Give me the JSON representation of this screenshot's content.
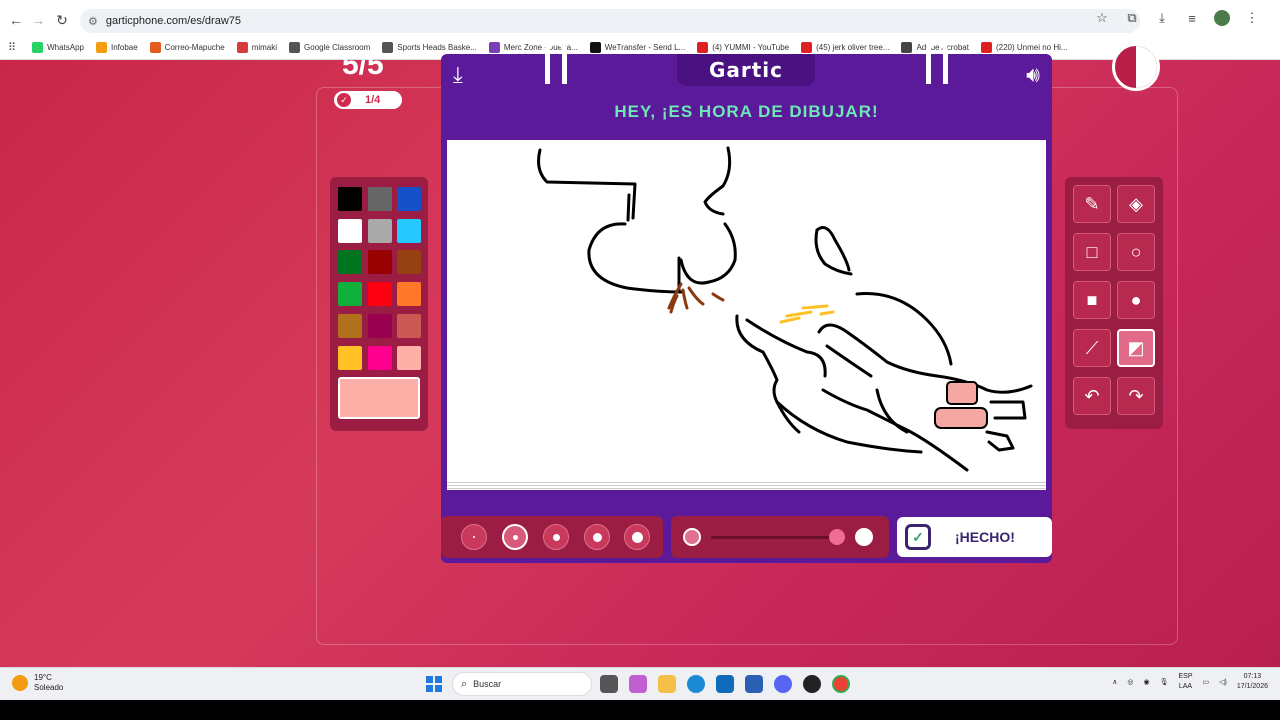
{
  "browser": {
    "url": "garticphone.com/es/draw75",
    "bookmarks": [
      {
        "label": "WhatsApp",
        "color": "#25d366"
      },
      {
        "label": "Infobae",
        "color": "#f39c12"
      },
      {
        "label": "Correo-Mapuche",
        "color": "#e25b1f"
      },
      {
        "label": "mimaki",
        "color": "#d63a3a"
      },
      {
        "label": "Google Classroom",
        "color": "#555555"
      },
      {
        "label": "Sports Heads Baske...",
        "color": "#555555"
      },
      {
        "label": "Merc Zone - Juega...",
        "color": "#7b3fb5"
      },
      {
        "label": "WeTransfer - Send L...",
        "color": "#111111"
      },
      {
        "label": "(4) YUMMI - YouTube",
        "color": "#e02020"
      },
      {
        "label": "(45) jerk oliver tree...",
        "color": "#e02020"
      },
      {
        "label": "Adobe Acrobat",
        "color": "#444444"
      },
      {
        "label": "(220) Unmei no Hi...",
        "color": "#e02020"
      }
    ]
  },
  "game": {
    "round": "5/5",
    "done_count": "1/4",
    "logo": "Gartic",
    "prompt": "HEY, ¡ES HORA DE DIBUJAR!",
    "done_button": "¡HECHO!",
    "colors": [
      "#000000",
      "#666666",
      "#1451c9",
      "#ffffff",
      "#aaaaaa",
      "#26c9ff",
      "#017420",
      "#990000",
      "#964112",
      "#11b03c",
      "#ff0013",
      "#ff7829",
      "#b0701c",
      "#99004e",
      "#cb5a57",
      "#ffc126",
      "#ff008f",
      "#feafa8"
    ],
    "selected_color": "#feafa8",
    "tools": [
      "pencil-icon",
      "eraser-icon",
      "rectangle-icon",
      "ellipse-icon",
      "filled-rectangle-icon",
      "filled-ellipse-icon",
      "line-icon",
      "fill-bucket-icon",
      "undo-icon",
      "redo-icon"
    ],
    "active_tool": "fill-bucket-icon"
  },
  "taskbar": {
    "temperature": "19°C",
    "weather": "Soleado",
    "search_placeholder": "Buscar",
    "lang_top": "ESP",
    "lang_bottom": "LAA",
    "time": "07:13",
    "date": "17/1/2026"
  }
}
